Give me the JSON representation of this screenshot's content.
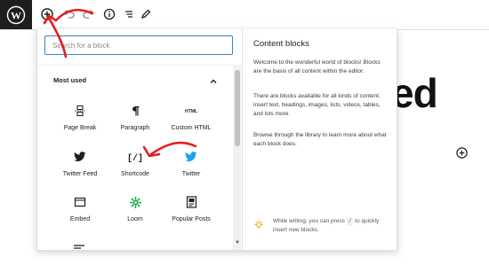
{
  "toolbar": {
    "logo_icon": "wordpress-logo-icon",
    "icons": [
      "add-block-icon",
      "undo-icon",
      "redo-icon",
      "info-icon",
      "list-view-icon",
      "edit-icon"
    ]
  },
  "editor": {
    "heading_fragment": "ed",
    "add_block_icon": "plus-circle-icon"
  },
  "inserter": {
    "search": {
      "placeholder": "Search for a block",
      "value": ""
    },
    "panel": {
      "title": "Most used"
    },
    "blocks": [
      {
        "label": "Page Break",
        "icon": "page-break-icon"
      },
      {
        "label": "Paragraph",
        "icon": "paragraph-icon"
      },
      {
        "label": "Custom HTML",
        "icon": "html-icon"
      },
      {
        "label": "Twitter Feed",
        "icon": "twitter-icon"
      },
      {
        "label": "Shortcode",
        "icon": "shortcode-icon"
      },
      {
        "label": "Twitter",
        "icon": "twitter-blue-icon"
      },
      {
        "label": "Embed",
        "icon": "embed-icon"
      },
      {
        "label": "Loom",
        "icon": "loom-icon"
      },
      {
        "label": "Popular Posts",
        "icon": "popular-posts-icon"
      }
    ],
    "preview": {
      "title": "Content blocks",
      "p1": "Welcome to the wonderful world of blocks! Blocks are the basis of all content within the editor.",
      "p2": "There are blocks available for all kinds of content: insert text, headings, images, lists, videos, tables, and lots more.",
      "p3": "Browse through the library to learn more about what each block does.",
      "tip_before": "While writing, you can press",
      "tip_key": "/",
      "tip_after": "to quickly insert new blocks."
    }
  },
  "colors": {
    "accent": "#3582c4",
    "annotation": "#e02020",
    "twitter_blue": "#1da1f2",
    "loom_green": "#1ca54c"
  }
}
